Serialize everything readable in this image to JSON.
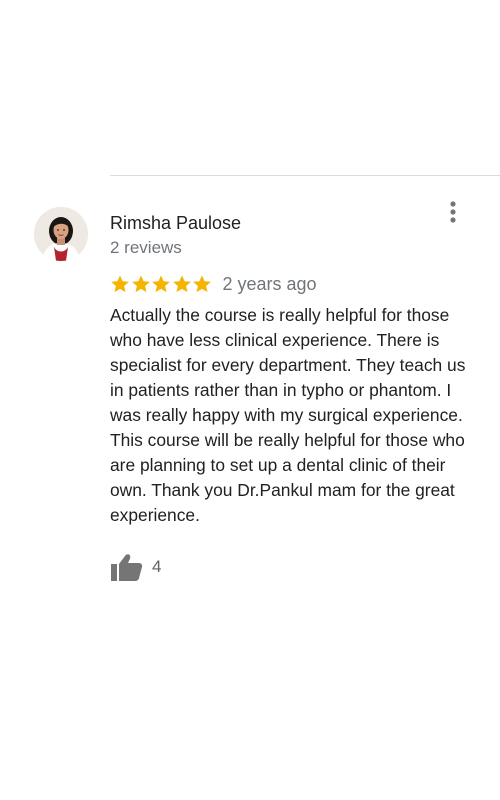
{
  "review": {
    "reviewer_name": "Rimsha Paulose",
    "review_count": "2 reviews",
    "rating": 5,
    "rating_max": 5,
    "date": "2 years ago",
    "text": "Actually the course is really helpful for those who have less clinical experience. There is specialist for every department. They teach us in patients rather than in typho or phantom. I was really happy with my surgical experience. This course will be really helpful for those who are planning to set up a dental clinic of their own. Thank you Dr.Pankul mam for the great experience.",
    "likes": "4"
  },
  "icons": {
    "more": "more-vert-icon",
    "like": "thumb-up-icon",
    "star": "star-icon"
  },
  "colors": {
    "star": "#f4b400",
    "secondary_text": "#70757a",
    "icon_gray": "#757575",
    "divider": "#dadce0"
  }
}
